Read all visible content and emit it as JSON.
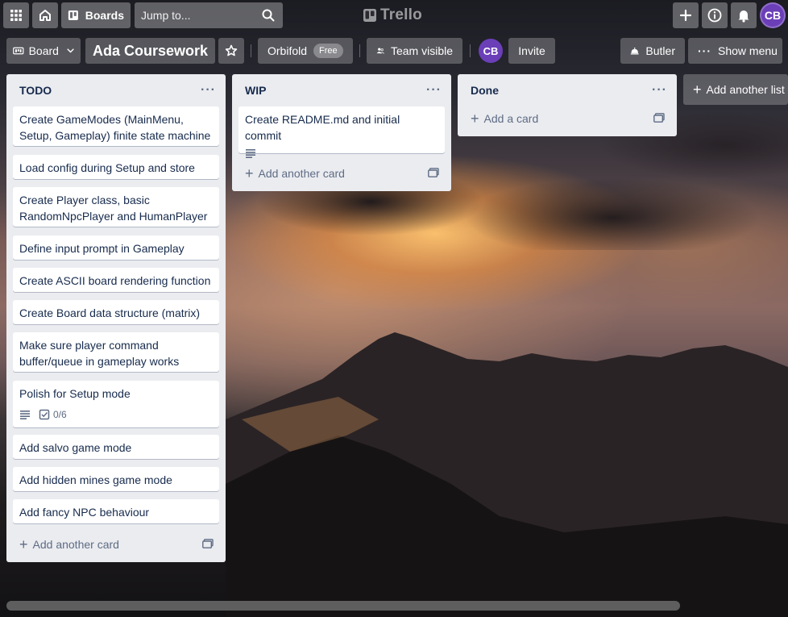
{
  "header": {
    "boards_label": "Boards",
    "search_placeholder": "Jump to...",
    "logo_text": "Trello",
    "avatar_initials": "CB"
  },
  "board": {
    "view_label": "Board",
    "title": "Ada Coursework",
    "workspace_name": "Orbifold",
    "workspace_badge": "Free",
    "visibility_label": "Team visible",
    "member_initials": "CB",
    "invite_label": "Invite",
    "butler_label": "Butler",
    "show_menu_label": "Show menu"
  },
  "lists": [
    {
      "title": "TODO",
      "cards": [
        {
          "title": "Create GameModes (MainMenu, Setup, Gameplay) finite state machine"
        },
        {
          "title": "Load config during Setup and store"
        },
        {
          "title": "Create Player class, basic RandomNpcPlayer and HumanPlayer"
        },
        {
          "title": "Define input prompt in Gameplay"
        },
        {
          "title": "Create ASCII board rendering function"
        },
        {
          "title": "Create Board data structure (matrix)"
        },
        {
          "title": "Make sure player command buffer/queue in gameplay works"
        },
        {
          "title": "Polish for Setup mode",
          "checklist": "0/6"
        },
        {
          "title": "Add salvo game mode"
        },
        {
          "title": "Add hidden mines game mode"
        },
        {
          "title": "Add fancy NPC behaviour"
        }
      ],
      "add_label": "Add another card"
    },
    {
      "title": "WIP",
      "cards": [
        {
          "title": "Create README.md and initial commit"
        }
      ],
      "add_label": "Add another card"
    },
    {
      "title": "Done",
      "cards": [],
      "add_label": "Add a card"
    }
  ],
  "add_list_label": "Add another list",
  "colors": {
    "list_bg": "#ebecf0",
    "avatar": "#6b3fb8",
    "card_text": "#172b4d",
    "muted": "#5e6c84"
  }
}
